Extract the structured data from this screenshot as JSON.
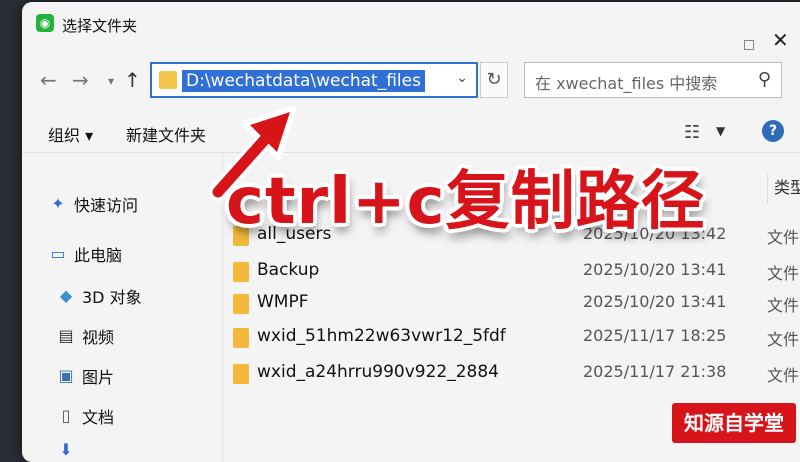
{
  "window": {
    "title": "选择文件夹"
  },
  "address_bar": {
    "path": "D:\\wechatdata\\wechat_files"
  },
  "search": {
    "placeholder": "在 xwechat_files 中搜索"
  },
  "toolbar": {
    "organize_label": "组织 ▾",
    "new_folder_label": "新建文件夹",
    "help_label": "?"
  },
  "sidebar": {
    "items": [
      {
        "label": "快速访问",
        "icon": "pin-icon"
      },
      {
        "label": "此电脑",
        "icon": "computer-icon"
      },
      {
        "label": "3D 对象",
        "icon": "cube-icon"
      },
      {
        "label": "视频",
        "icon": "video-icon"
      },
      {
        "label": "图片",
        "icon": "picture-icon"
      },
      {
        "label": "文档",
        "icon": "document-icon"
      },
      {
        "label": "",
        "icon": "download-icon"
      }
    ]
  },
  "list": {
    "type_header": "类型",
    "rows": [
      {
        "name": "all_users",
        "date": "2025/10/20 13:42",
        "type": "文件"
      },
      {
        "name": "Backup",
        "date": "2025/10/20 13:41",
        "type": "文件"
      },
      {
        "name": "WMPF",
        "date": "2025/10/20 13:41",
        "type": "文件"
      },
      {
        "name": "wxid_51hm22w63vwr12_5fdf",
        "date": "2025/11/17 18:25",
        "type": "文件"
      },
      {
        "name": "wxid_a24hrru990v922_2884",
        "date": "2025/11/17 21:38",
        "type": "文件"
      }
    ]
  },
  "overlay": {
    "caption": "ctrl+c复制路径",
    "watermark": "知源自学堂"
  },
  "colors": {
    "accent": "#2f6fd6",
    "caption_red": "#d8141b",
    "folder_yellow": "#f2b93b"
  }
}
